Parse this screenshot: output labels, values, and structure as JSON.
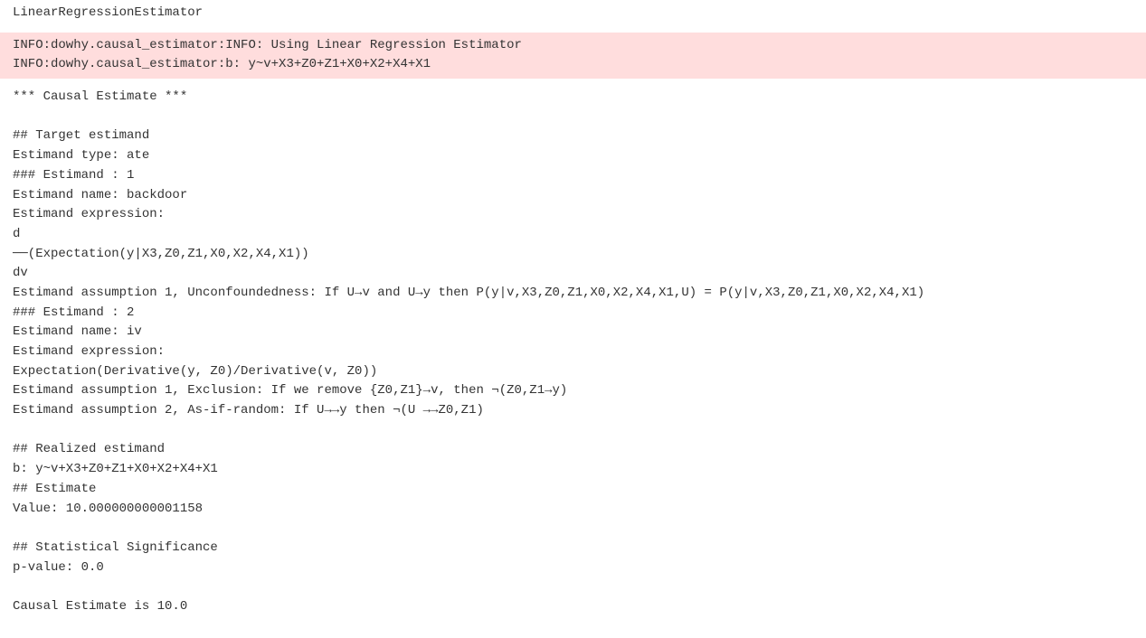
{
  "title": "LinearRegressionEstimator",
  "stderr": {
    "line1": "INFO:dowhy.causal_estimator:INFO: Using Linear Regression Estimator",
    "line2": "INFO:dowhy.causal_estimator:b: y~v+X3+Z0+Z1+X0+X2+X4+X1"
  },
  "out": {
    "header": "*** Causal Estimate ***",
    "target_estimand_header": "## Target estimand",
    "estimand_type": "Estimand type: ate",
    "estimand1_header": "### Estimand : 1",
    "estimand1_name": "Estimand name: backdoor",
    "estimand1_expr_label": "Estimand expression:",
    "estimand1_expr_l1": "d",
    "estimand1_expr_l2": "──(Expectation(y|X3,Z0,Z1,X0,X2,X4,X1))",
    "estimand1_expr_l3": "dv",
    "estimand1_assumption1": "Estimand assumption 1, Unconfoundedness: If U→v and U→y then P(y|v,X3,Z0,Z1,X0,X2,X4,X1,U) = P(y|v,X3,Z0,Z1,X0,X2,X4,X1)",
    "estimand2_header": "### Estimand : 2",
    "estimand2_name": "Estimand name: iv",
    "estimand2_expr_label": "Estimand expression:",
    "estimand2_expr": "Expectation(Derivative(y, Z0)/Derivative(v, Z0))",
    "estimand2_assumption1": "Estimand assumption 1, Exclusion: If we remove {Z0,Z1}→v, then ¬(Z0,Z1→y)",
    "estimand2_assumption2": "Estimand assumption 2, As-if-random: If U→→y then ¬(U →→Z0,Z1)",
    "realized_header": "## Realized estimand",
    "realized_value": "b: y~v+X3+Z0+Z1+X0+X2+X4+X1",
    "estimate_header": "## Estimate",
    "estimate_value": "Value: 10.000000000001158",
    "statsig_header": "## Statistical Significance",
    "pvalue": "p-value: 0.0",
    "causal_estimate_final": "Causal Estimate is 10.0"
  }
}
